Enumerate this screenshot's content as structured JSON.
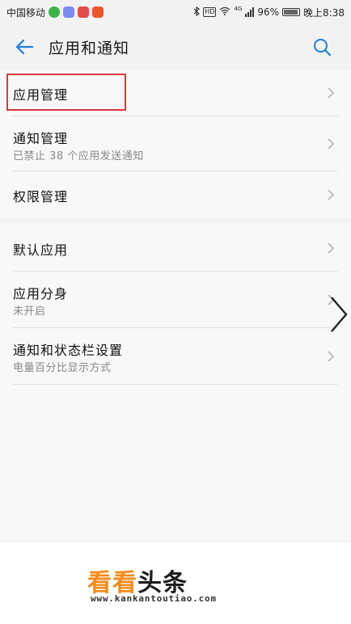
{
  "status_bar": {
    "carrier": "中国移动",
    "hd_label": "HD",
    "network": "4G",
    "battery": "96%",
    "time": "晚上8:38",
    "icons": [
      "wechat-icon",
      "app-icon",
      "netease-icon",
      "weibo-icon",
      "bluetooth-icon",
      "wifi-icon",
      "signal-icon",
      "battery-icon"
    ]
  },
  "header": {
    "title": "应用和通知",
    "back_icon": "back-arrow-icon",
    "search_icon": "search-icon",
    "accent_color": "#1e7fd6"
  },
  "settings": {
    "items": [
      {
        "title": "应用管理",
        "subtitle": ""
      },
      {
        "title": "通知管理",
        "subtitle": "已禁止 38 个应用发送通知"
      },
      {
        "title": "权限管理",
        "subtitle": ""
      },
      {
        "title": "默认应用",
        "subtitle": ""
      },
      {
        "title": "应用分身",
        "subtitle": "未开启"
      },
      {
        "title": "通知和状态栏设置",
        "subtitle": "电量百分比显示方式"
      }
    ]
  },
  "annotation": {
    "highlight_color": "#d9383a"
  },
  "watermark": {
    "brand_orange": "看看",
    "brand_dark": "头条",
    "url": "www.kankantoutiao.com"
  }
}
